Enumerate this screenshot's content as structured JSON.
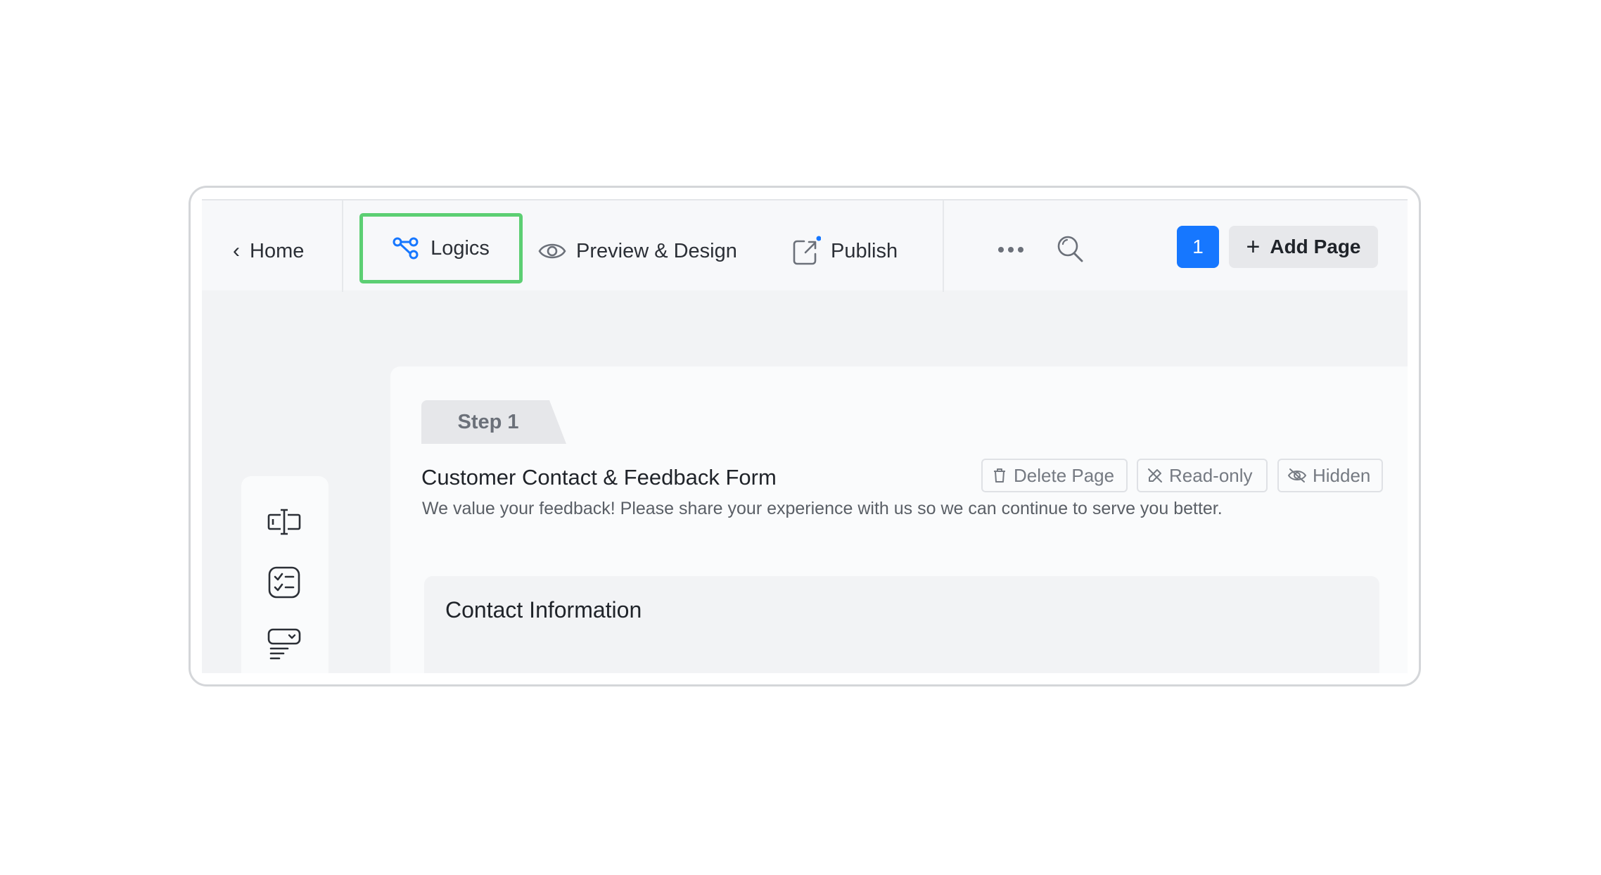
{
  "nav": {
    "home_label": "Home"
  },
  "tabs": {
    "logics": "Logics",
    "preview": "Preview & Design",
    "publish": "Publish"
  },
  "toolbar": {
    "page_number": "1",
    "add_page_label": "Add Page"
  },
  "sidebar_tools": [
    "text-field-icon",
    "checklist-icon",
    "dropdown-icon"
  ],
  "page": {
    "step_label": "Step 1",
    "title": "Customer Contact & Feedback Form",
    "description": "We value your feedback! Please share your experience with us so we can continue to serve you better.",
    "actions": {
      "delete": "Delete Page",
      "readonly": "Read-only",
      "hidden": "Hidden"
    },
    "section_title": "Contact Information"
  },
  "colors": {
    "accent": "#1677ff",
    "highlight_border": "#5ccf73",
    "publish_dot": "#1677ff"
  }
}
